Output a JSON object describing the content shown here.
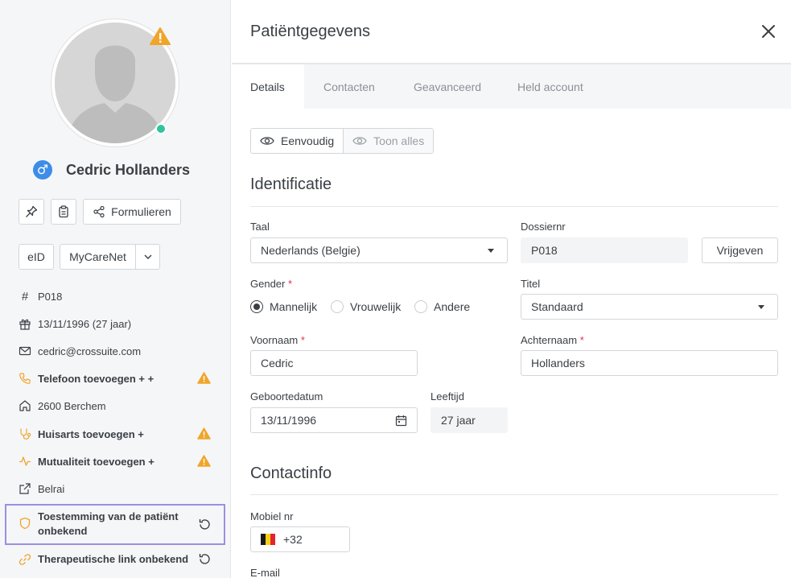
{
  "sidebar": {
    "patient_name": "Cedric Hollanders",
    "gender_symbol": "♂",
    "buttons": {
      "forms_label": "Formulieren",
      "eid_label": "eID",
      "mycarenet_label": "MyCareNet"
    },
    "info": {
      "dossier": "P018",
      "birthdate": "13/11/1996 (27 jaar)",
      "email": "cedric@crossuite.com",
      "phone": "Telefoon toevoegen + +",
      "address": "2600 Berchem",
      "gp": "Huisarts toevoegen +",
      "mutuality": "Mutualiteit toevoegen +",
      "belrai": "Belrai",
      "consent": "Toestemming van de patiënt onbekend",
      "therapeutic_link": "Therapeutische link onbekend"
    }
  },
  "main": {
    "title": "Patiëntgegevens",
    "tabs": [
      "Details",
      "Contacten",
      "Geavanceerd",
      "Held account"
    ],
    "view_toggle": {
      "simple": "Eenvoudig",
      "all": "Toon alles"
    },
    "identification": {
      "title": "Identificatie",
      "language_label": "Taal",
      "language_value": "Nederlands (Belgie)",
      "dossier_label": "Dossiernr",
      "dossier_value": "P018",
      "release_button": "Vrijgeven",
      "gender_label": "Gender",
      "gender_options": [
        "Mannelijk",
        "Vrouwelijk",
        "Andere"
      ],
      "title_label": "Titel",
      "title_value": "Standaard",
      "firstname_label": "Voornaam",
      "firstname_value": "Cedric",
      "lastname_label": "Achternaam",
      "lastname_value": "Hollanders",
      "birthdate_label": "Geboortedatum",
      "birthdate_value": "13/11/1996",
      "age_label": "Leeftijd",
      "age_value": "27 jaar",
      "required_mark": "*"
    },
    "contact": {
      "title": "Contactinfo",
      "mobile_label": "Mobiel nr",
      "mobile_prefix": "+32",
      "email_label": "E-mail"
    }
  },
  "colors": {
    "accent_blue": "#3d8de8",
    "warning": "#f0a52a",
    "online": "#2ec4a0",
    "highlight_border": "#9b8fe0",
    "required": "#e0334a"
  }
}
